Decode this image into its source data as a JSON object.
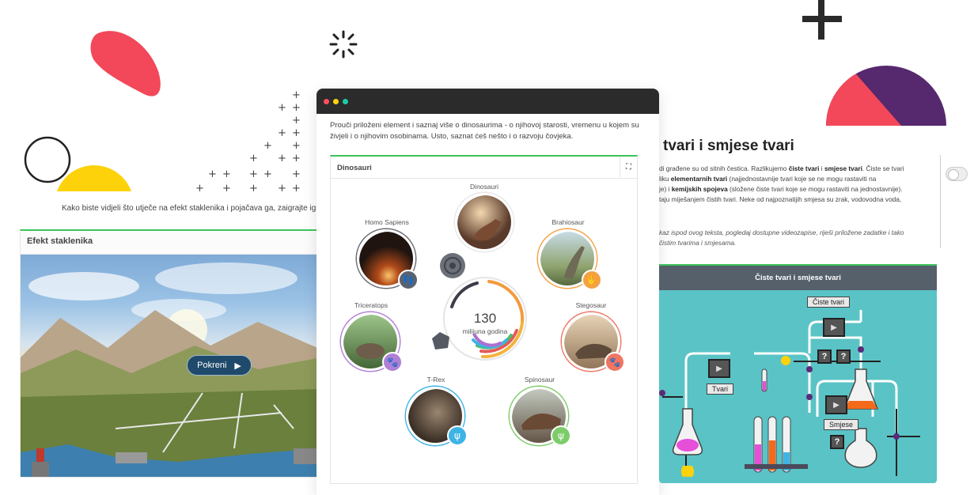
{
  "left_section": {
    "caption": "Kako biste vidjeli što utječe na efekt staklenika i pojačava ga, zaigrajte igricu u",
    "card_title": "Efekt staklenika",
    "play_label": "Pokreni",
    "play_icon": "▶"
  },
  "dino_window": {
    "intro": "Prouči priloženi element i saznaj više o dinosaurima - o njihovoj starosti, vremenu u kojem su živjeli i o njihovim osobinama. Usto, saznat ćeš nešto i o razvoju čovjeka.",
    "card_title": "Dinosauri",
    "expand_icon": "⛶",
    "center_value": "130",
    "center_unit": "milijuna godina",
    "items": [
      {
        "label": "Dinosauri"
      },
      {
        "label": "Homo Sapiens"
      },
      {
        "label": "Brahiosaur"
      },
      {
        "label": "Triceratops"
      },
      {
        "label": "Stegosaur"
      },
      {
        "label": "T-Rex"
      },
      {
        "label": "Spinosaur"
      }
    ]
  },
  "right_section": {
    "title": "tvari i smjese tvari",
    "p1_a": "di građene su od sitnih čestica. Razlikujemo ",
    "p1_b": "čiste tvari",
    "p1_c": " i ",
    "p1_d": "smjese tvari",
    "p1_e": ". Čiste se tvari",
    "p2_a": "liku ",
    "p2_b": "elementarnih tvari",
    "p2_c": " (najjednostavnije tvari koje se ne mogu rastaviti na",
    "p3_a": "je) i ",
    "p3_b": "kemijskih spojeva",
    "p3_c": " (složene čiste tvari koje se mogu rastaviti na jednostavnije).",
    "p4": "taju miješanjem čistih tvari. Neke od najpoznatijih smjesa su zrak, vodovodna voda,",
    "italic1": "kaz ispod ovog teksta, pogledaj dostupne videozapise, riješi priložene zadatke i tako",
    "italic2": "čistim tvarima i smjesama.",
    "chem_title": "Čiste tvari i smjese tvari",
    "lbl_ciste": "Čiste tvari",
    "lbl_tvari": "Tvari",
    "lbl_smjese": "Smjese",
    "q": "?"
  }
}
